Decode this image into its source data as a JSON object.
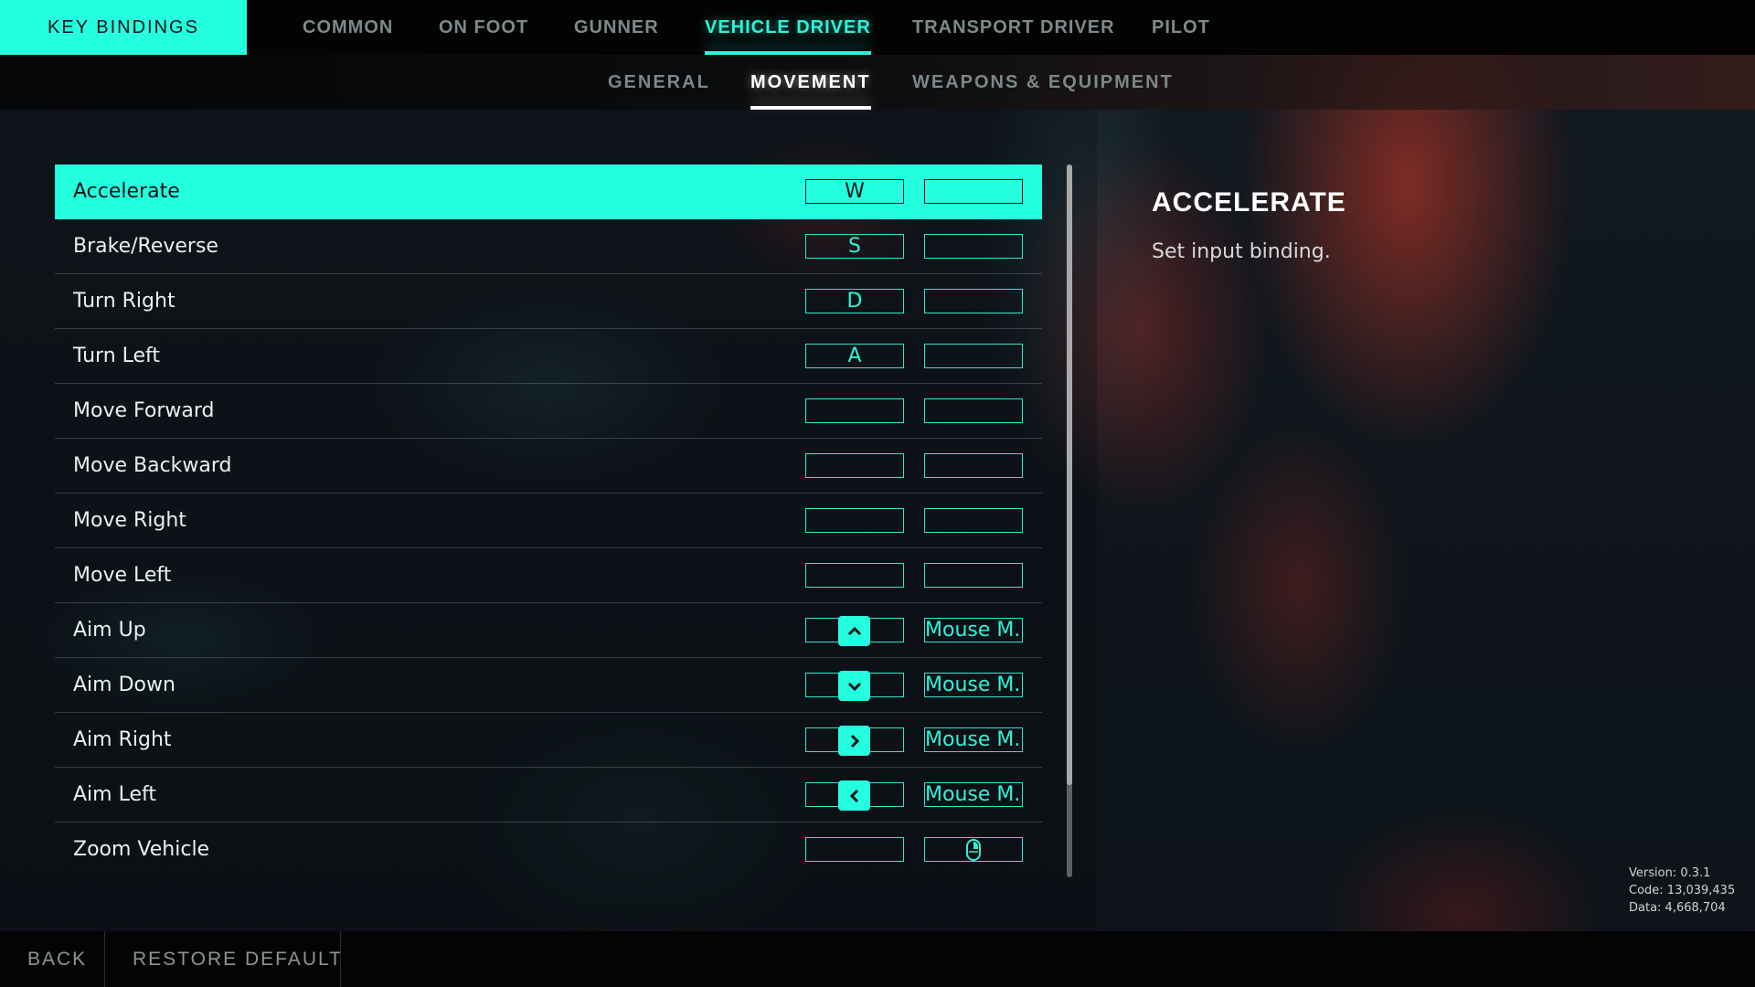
{
  "header": {
    "section_title": "KEY BINDINGS",
    "tabs": [
      {
        "label": "COMMON",
        "active": false
      },
      {
        "label": "ON FOOT",
        "active": false
      },
      {
        "label": "GUNNER",
        "active": false
      },
      {
        "label": "VEHICLE DRIVER",
        "active": true
      },
      {
        "label": "TRANSPORT DRIVER",
        "active": false
      },
      {
        "label": "PILOT",
        "active": false
      }
    ],
    "subtabs": [
      {
        "label": "GENERAL",
        "active": false
      },
      {
        "label": "MOVEMENT",
        "active": true
      },
      {
        "label": "WEAPONS & EQUIPMENT",
        "active": false
      }
    ]
  },
  "bindings": [
    {
      "action": "Accelerate",
      "primary": "W",
      "secondary": "",
      "selected": true
    },
    {
      "action": "Brake/Reverse",
      "primary": "S",
      "secondary": ""
    },
    {
      "action": "Turn Right",
      "primary": "D",
      "secondary": ""
    },
    {
      "action": "Turn Left",
      "primary": "A",
      "secondary": ""
    },
    {
      "action": "Move Forward",
      "primary": "",
      "secondary": ""
    },
    {
      "action": "Move Backward",
      "primary": "",
      "secondary": ""
    },
    {
      "action": "Move Right",
      "primary": "",
      "secondary": ""
    },
    {
      "action": "Move Left",
      "primary": "",
      "secondary": ""
    },
    {
      "action": "Aim Up",
      "primary_icon": "arrow-up-key-icon",
      "secondary": "Mouse M..."
    },
    {
      "action": "Aim Down",
      "primary_icon": "arrow-down-key-icon",
      "secondary": "Mouse M..."
    },
    {
      "action": "Aim Right",
      "primary_icon": "arrow-right-key-icon",
      "secondary": "Mouse M..."
    },
    {
      "action": "Aim Left",
      "primary_icon": "arrow-left-key-icon",
      "secondary": "Mouse M..."
    },
    {
      "action": "Zoom Vehicle",
      "primary": "",
      "secondary_icon": "mouse-right-button-icon"
    }
  ],
  "scrollbar": {
    "visible_fraction": 0.87,
    "position": 0
  },
  "detail": {
    "title": "ACCELERATE",
    "description": "Set input binding."
  },
  "version_info": {
    "version": "Version: 0.3.1",
    "code": "Code: 13,039,435",
    "data": "Data: 4,668,704"
  },
  "footer": {
    "back_label": "BACK",
    "restore_label": "RESTORE DEFAULT"
  },
  "colors": {
    "accent": "#24ffe0",
    "text_muted": "#7d8a8b",
    "background": "#0f141a"
  }
}
